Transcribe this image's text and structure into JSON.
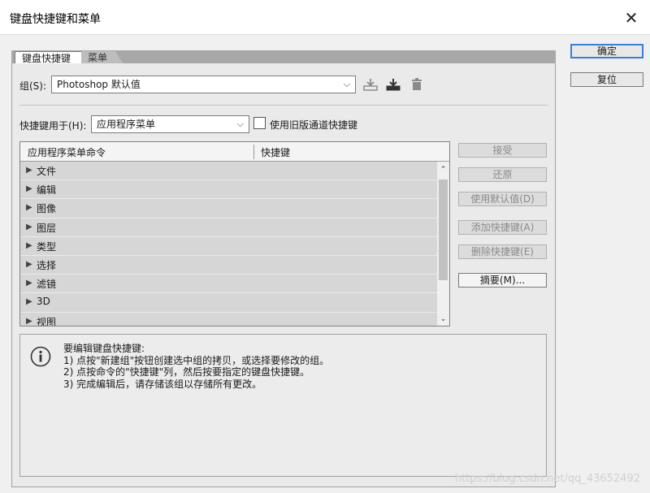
{
  "window": {
    "title": "键盘快捷键和菜单"
  },
  "tabs": [
    {
      "label": "键盘快捷键",
      "active": true
    },
    {
      "label": "菜单",
      "active": false
    }
  ],
  "group": {
    "label": "组(S):",
    "value": "Photoshop 默认值"
  },
  "shortcuts_for": {
    "label": "快捷键用于(H):",
    "value": "应用程序菜单"
  },
  "legacy_checkbox": {
    "label": "使用旧版通道快捷键",
    "checked": false
  },
  "table": {
    "columns": [
      "应用程序菜单命令",
      "快捷键"
    ],
    "rows": [
      {
        "name": "文件"
      },
      {
        "name": "编辑"
      },
      {
        "name": "图像"
      },
      {
        "name": "图层"
      },
      {
        "name": "类型"
      },
      {
        "name": "选择"
      },
      {
        "name": "滤镜"
      },
      {
        "name": "3D"
      },
      {
        "name": "视图"
      }
    ]
  },
  "side_buttons": {
    "accept": "接受",
    "undo": "还原",
    "use_default": "使用默认值(D)",
    "add_shortcut": "添加快捷键(A)",
    "delete_shortcut": "删除快捷键(E)",
    "summarize": "摘要(M)..."
  },
  "dialog_buttons": {
    "ok": "确定",
    "reset": "复位"
  },
  "info": {
    "lines": [
      "要编辑键盘快捷键:",
      "1) 点按\"新建组\"按钮创建选中组的拷贝，或选择要修改的组。",
      "2) 点按命令的\"快捷键\"列，然后按要指定的键盘快捷键。",
      "3) 完成编辑后，请存储该组以存储所有更改。"
    ]
  },
  "watermark": "https://blog.csdn.net/qq_43652492",
  "icons": [
    "close-icon",
    "save-set-icon",
    "new-set-icon",
    "delete-icon",
    "info-icon",
    "chevron-down-icon"
  ],
  "colors": {
    "default_button_border": "#3a7fd3"
  }
}
